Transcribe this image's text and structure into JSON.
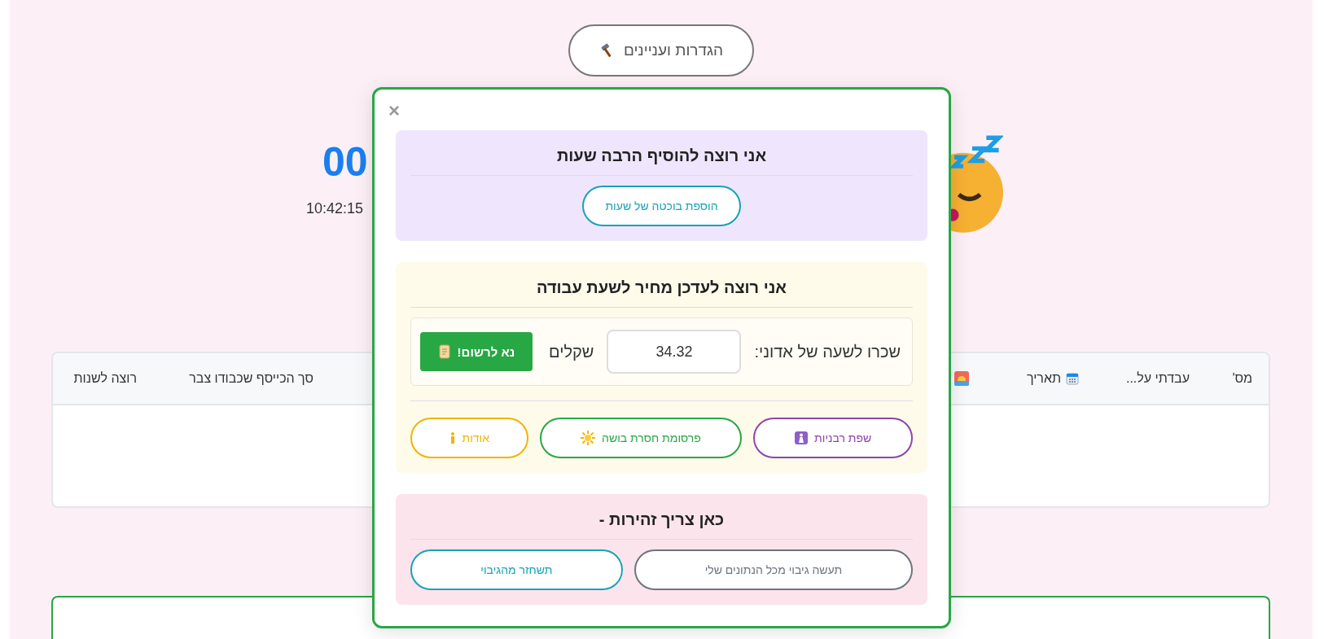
{
  "settings_button": {
    "label": "הגדרות ועניינים"
  },
  "counter": {
    "value": "00",
    "time": "10:42:15"
  },
  "table": {
    "columns": [
      {
        "kind": "text",
        "label": "מס'"
      },
      {
        "kind": "text",
        "label": "עבדתי על..."
      },
      {
        "kind": "date",
        "label": "תאריך"
      },
      {
        "kind": "time_of_day"
      },
      {
        "kind": "text",
        "label": "סך הכייסף שכבודו צבר"
      },
      {
        "kind": "text",
        "label": "רוצה לשנות"
      }
    ]
  },
  "modal": {
    "close": "×",
    "sections": [
      {
        "kind": "add_hours",
        "title": "אני רוצה להוסיף הרבה שעות",
        "buttons": [
          {
            "kind": "plain",
            "label": "הוספת בוכטה של שעות",
            "color": "#17a2b8"
          }
        ]
      },
      {
        "kind": "rate",
        "title": "אני רוצה לעדכן מחיר לשעת עבודה",
        "rate_label": "שכרו לשעה של אדוני:",
        "rate_value": "34.32",
        "currency": "שקלים",
        "save_button": "נא לרשום!",
        "buttons": [
          {
            "kind": "language",
            "label": "שפת רבניות",
            "color": "#8e44ad"
          },
          {
            "kind": "publicity",
            "label": "פרסומת חסרת בושה",
            "color": "#28a745"
          },
          {
            "kind": "about",
            "label": "אודות",
            "color": "#f0b400"
          }
        ]
      },
      {
        "kind": "warning",
        "title": "כאן צריך זהירות -",
        "buttons": [
          {
            "kind": "plain",
            "label": "תעשה גיבוי מכל הנתונים שלי",
            "color": "#6c757d"
          },
          {
            "kind": "plain",
            "label": "תשחזר מהגיבוי",
            "color": "#17a2b8"
          }
        ]
      }
    ]
  }
}
